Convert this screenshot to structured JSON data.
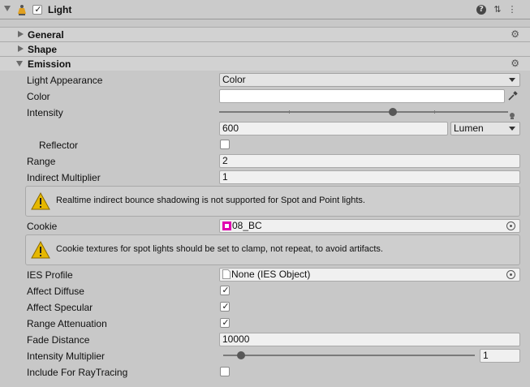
{
  "component": {
    "title": "Light",
    "enabled": true,
    "icons": [
      "help-icon",
      "presets-icon",
      "more-options-icon"
    ],
    "help_glyph": "?",
    "presets_glyph": "⇅",
    "more_glyph": "⋮"
  },
  "sections": {
    "general": {
      "label": "General",
      "expanded": false
    },
    "shape": {
      "label": "Shape",
      "expanded": false
    },
    "emission": {
      "label": "Emission",
      "expanded": true
    }
  },
  "section_gear_glyph": "⚙",
  "emission": {
    "light_appearance": {
      "label": "Light Appearance",
      "value": "Color"
    },
    "color": {
      "label": "Color",
      "value": "#ffffff"
    },
    "intensity": {
      "label": "Intensity",
      "value": "600",
      "unit": "Lumen",
      "slider_fraction": 0.6
    },
    "reflector": {
      "label": "Reflector",
      "checked": false
    },
    "range": {
      "label": "Range",
      "value": "2"
    },
    "indirect_multiplier": {
      "label": "Indirect Multiplier",
      "value": "1"
    },
    "warning_indirect": "Realtime indirect bounce shadowing is not supported for Spot and Point lights.",
    "cookie": {
      "label": "Cookie",
      "value": "08_BC"
    },
    "warning_cookie": "Cookie textures for spot lights should be set to clamp, not repeat, to avoid artifacts.",
    "ies_profile": {
      "label": "IES Profile",
      "value": "None (IES Object)"
    },
    "affect_diffuse": {
      "label": "Affect Diffuse",
      "checked": true
    },
    "affect_specular": {
      "label": "Affect Specular",
      "checked": true
    },
    "range_attenuation": {
      "label": "Range Attenuation",
      "checked": true
    },
    "fade_distance": {
      "label": "Fade Distance",
      "value": "10000"
    },
    "intensity_multiplier": {
      "label": "Intensity Multiplier",
      "value": "1",
      "slider_fraction": 0.07
    },
    "include_raytracing": {
      "label": "Include For RayTracing",
      "checked": false
    }
  },
  "colors": {
    "cookie_icon": "#e000b0",
    "warning_icon": "#e6b800"
  },
  "check_glyph": "✓"
}
